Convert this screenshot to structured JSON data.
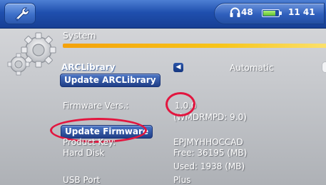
{
  "colors": {
    "topbar": "#1f4fae",
    "accent_underline": "#f7b10e",
    "annotation_ring": "#e2163f",
    "selected_button": "#203e86"
  },
  "topbar": {
    "tool_icon": "wrench-icon",
    "volume_icon": "headphones-icon",
    "volume": "48",
    "battery_icon": "battery-icon",
    "battery_level": 0.8,
    "time": "11 41"
  },
  "section": {
    "icon": "gear-icon",
    "title": "System"
  },
  "arclibrary": {
    "label": "ARCLibrary",
    "arrow_icon": "arrow-left-icon",
    "value": "Automatic",
    "update_button": "Update ARCLibrary"
  },
  "firmware": {
    "label": "Firmware Vers.:",
    "version": "1.0.0",
    "wmdrmpd": "(WMDRMPD: 9.0)",
    "update_button": "Update Firmware"
  },
  "product_key": {
    "label": "Product Key:",
    "value": "EPJMYHHOCCAD"
  },
  "hard_disk": {
    "label": "Hard Disk",
    "free": "Free: 36195 (MB)",
    "used": "Used: 1938 (MB)"
  },
  "usb_port": {
    "label": "USB Port",
    "value": "Plus"
  }
}
